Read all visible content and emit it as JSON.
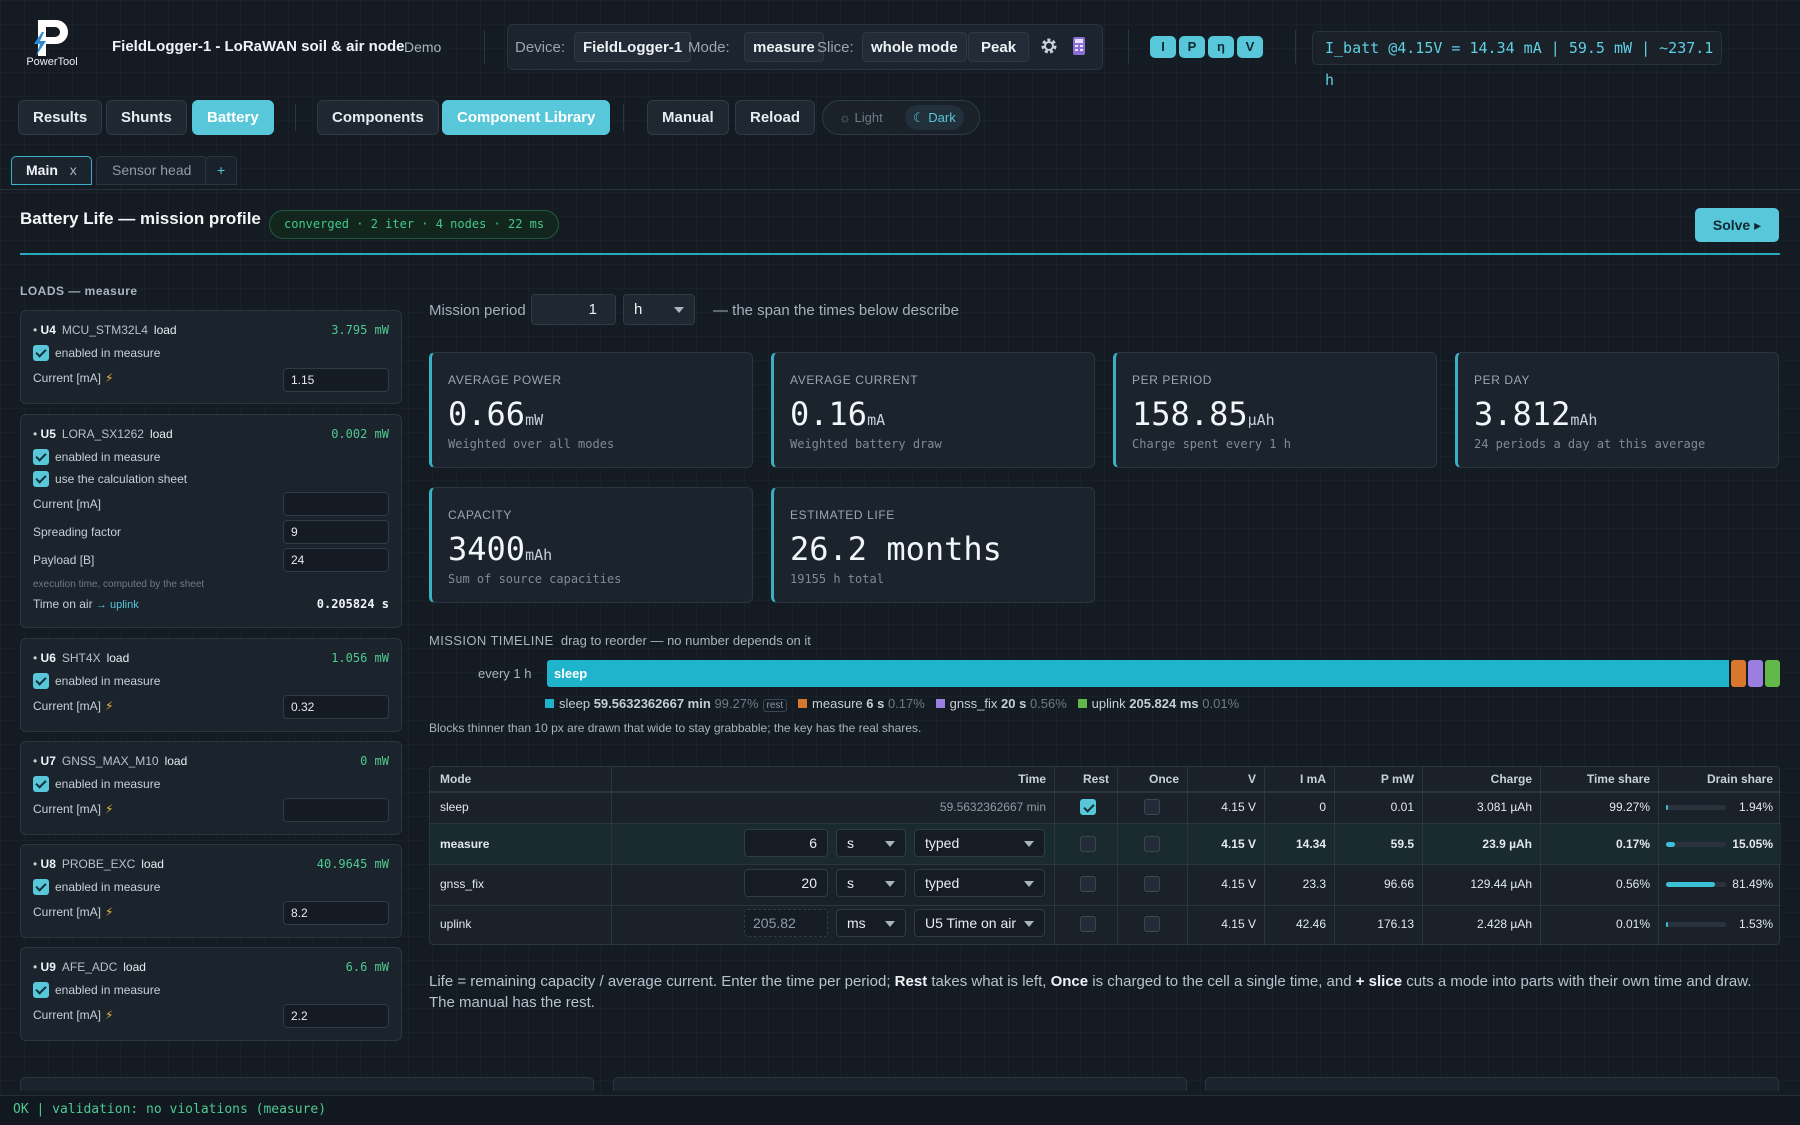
{
  "header": {
    "logo_text": "PowerTool",
    "title": "FieldLogger-1 - LoRaWAN soil & air node",
    "demo": "Demo",
    "device_label": "Device:",
    "device_value": "FieldLogger-1",
    "mode_label": "Mode:",
    "mode_value": "measure",
    "slice_label": "Slice:",
    "slice_value": "whole mode",
    "peak_label": "Peak",
    "chips": [
      "I",
      "P",
      "η",
      "V"
    ],
    "ibatt": "I_batt @4.15V = 14.34 mA | 59.5 mW | ~237.1 h"
  },
  "toolbar": {
    "results": "Results",
    "shunts": "Shunts",
    "battery": "Battery",
    "components": "Components",
    "component_library": "Component Library",
    "manual": "Manual",
    "reload": "Reload",
    "light": "Light",
    "dark": "Dark"
  },
  "tabs": [
    {
      "label": "Main",
      "close": "x"
    },
    {
      "label": "Sensor head"
    },
    {
      "label": "+"
    }
  ],
  "section": {
    "title": "Battery Life — mission profile",
    "badge": "converged · 2 iter · 4 nodes · 22 ms",
    "solve": "Solve ▸"
  },
  "loads": {
    "heading": "LOADS — measure",
    "enabled_text": "enabled in measure",
    "current_label": "Current [mA]",
    "cards": [
      {
        "ref": "U4",
        "part": "MCU_STM32L4",
        "kind": "load",
        "mw": "3.795 mW",
        "current": "1.15"
      },
      {
        "ref": "U5",
        "part": "LORA_SX1262",
        "kind": "load",
        "mw": "0.002 mW",
        "current": "",
        "sheet_text": "use the calculation sheet",
        "sf_label": "Spreading factor",
        "sf": "9",
        "payload_label": "Payload [B]",
        "payload": "24",
        "exec_note": "execution time, computed by the sheet",
        "toa_label": "Time on air",
        "toa_link": "→ uplink",
        "toa_value": "0.205824 s"
      },
      {
        "ref": "U6",
        "part": "SHT4X",
        "kind": "load",
        "mw": "1.056 mW",
        "current": "0.32"
      },
      {
        "ref": "U7",
        "part": "GNSS_MAX_M10",
        "kind": "load",
        "mw": "0 mW",
        "current": ""
      },
      {
        "ref": "U8",
        "part": "PROBE_EXC",
        "kind": "load",
        "mw": "40.9645 mW",
        "current": "8.2"
      },
      {
        "ref": "U9",
        "part": "AFE_ADC",
        "kind": "load",
        "mw": "6.6 mW",
        "current": "2.2"
      }
    ]
  },
  "mission": {
    "label": "Mission period",
    "value": "1",
    "unit": "h",
    "desc": "— the span the times below describe"
  },
  "stats": [
    {
      "label": "AVERAGE POWER",
      "value": "0.66",
      "unit": "mW",
      "sub": "Weighted over all modes"
    },
    {
      "label": "AVERAGE CURRENT",
      "value": "0.16",
      "unit": "mA",
      "sub": "Weighted battery draw"
    },
    {
      "label": "PER PERIOD",
      "value": "158.85",
      "unit": "µAh",
      "sub": "Charge spent every 1 h"
    },
    {
      "label": "PER DAY",
      "value": "3.812",
      "unit": "mAh",
      "sub": "24 periods a day at this average"
    },
    {
      "label": "CAPACITY",
      "value": "3400",
      "unit": "mAh",
      "sub": "Sum of source capacities"
    },
    {
      "label": "ESTIMATED LIFE",
      "value": "26.2 months",
      "unit": "",
      "sub": "19155 h total"
    }
  ],
  "timeline": {
    "heading": "MISSION TIMELINE",
    "hint": "drag to reorder — no number depends on it",
    "every": "every 1 h",
    "bar_label": "sleep",
    "colors": {
      "sleep": "#1fb3cc",
      "measure": "#d9772e",
      "gnss_fix": "#9b7fe0",
      "uplink": "#63b84a"
    },
    "legend": [
      {
        "name": "sleep",
        "time": "59.5632362667 min",
        "share": "99.27%",
        "tag": "rest",
        "fraction": 0.9927
      },
      {
        "name": "measure",
        "time": "6 s",
        "share": "0.17%",
        "fraction": 0.0017
      },
      {
        "name": "gnss_fix",
        "time": "20 s",
        "share": "0.56%",
        "fraction": 0.0056
      },
      {
        "name": "uplink",
        "time": "205.824 ms",
        "share": "0.01%",
        "fraction": 0.0001
      }
    ],
    "note": "Blocks thinner than 10 px are drawn that wide to stay grabbable; the key has the real shares."
  },
  "table": {
    "headers": [
      "Mode",
      "Time",
      "Rest",
      "Once",
      "V",
      "I mA",
      "P mW",
      "Charge",
      "Time share",
      "Drain share"
    ],
    "rows": [
      {
        "mode": "sleep",
        "time_text": "59.5632362667 min",
        "rest": true,
        "once": false,
        "v": "4.15 V",
        "i": "0",
        "p": "0.01",
        "charge": "3.081 µAh",
        "tshare": "99.27%",
        "dshare": "1.94%",
        "dfrac": 0.0194
      },
      {
        "mode": "measure",
        "time_val": "6",
        "time_unit": "s",
        "source": "typed",
        "rest": false,
        "once": false,
        "v": "4.15 V",
        "i": "14.34",
        "p": "59.5",
        "charge": "23.9 µAh",
        "tshare": "0.17%",
        "dshare": "15.05%",
        "dfrac": 0.1505
      },
      {
        "mode": "gnss_fix",
        "time_val": "20",
        "time_unit": "s",
        "source": "typed",
        "rest": false,
        "once": false,
        "v": "4.15 V",
        "i": "23.3",
        "p": "96.66",
        "charge": "129.44 µAh",
        "tshare": "0.56%",
        "dshare": "81.49%",
        "dfrac": 0.8149
      },
      {
        "mode": "uplink",
        "time_val": "205.82",
        "time_unit": "ms",
        "source": "U5 Time on air",
        "rest": false,
        "once": false,
        "v": "4.15 V",
        "i": "42.46",
        "p": "176.13",
        "charge": "2.428 µAh",
        "tshare": "0.01%",
        "dshare": "1.53%",
        "dfrac": 0.0153
      }
    ]
  },
  "footer": {
    "t1": "Life = remaining capacity / average current. Enter the time per period; ",
    "rest": "Rest",
    "t2": " takes what is left, ",
    "once": "Once",
    "t3": " is charged to the cell a single time, and ",
    "slice": "+ slice",
    "t4": " cuts a mode into parts with their own time and draw.",
    "t5": "The manual has the rest."
  },
  "status": "OK | validation: no violations (measure)"
}
